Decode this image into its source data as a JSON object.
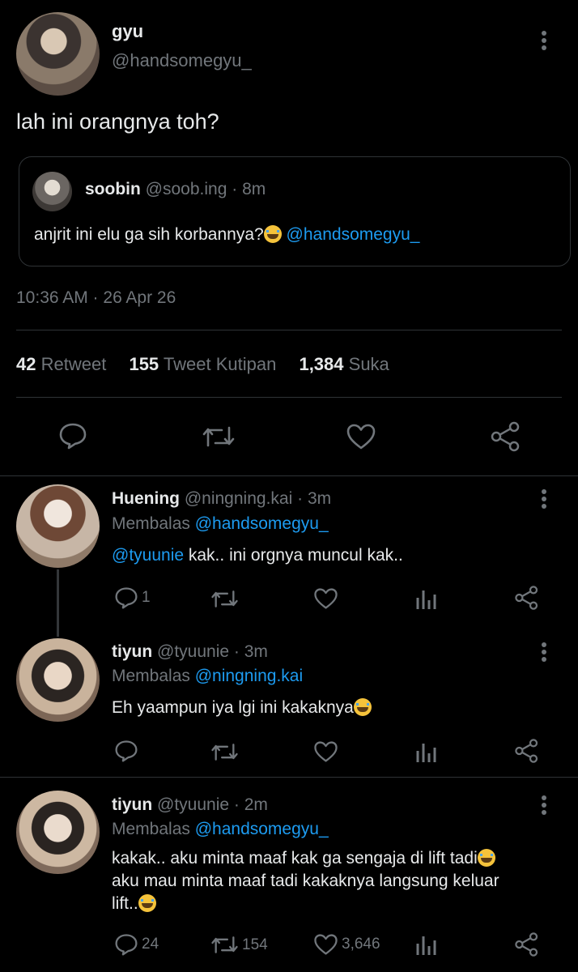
{
  "main_tweet": {
    "name": "gyu",
    "handle": "@handsomegyu_",
    "text": "lah ini orangnya toh?",
    "timestamp": "10:36 AM · 26 Apr 26",
    "quote": {
      "name": "soobin",
      "handle": "@soob.ing",
      "sep": "·",
      "time": "8m",
      "text": "anjrit ini elu ga sih korbannya?",
      "mention": "@handsomegyu_"
    },
    "stats": {
      "retweets": "42",
      "retweets_label": "Retweet",
      "quotes": "155",
      "quotes_label": "Tweet Kutipan",
      "likes": "1,384",
      "likes_label": "Suka"
    }
  },
  "replies": [
    {
      "name": "Huening",
      "handle": "@ningning.kai",
      "sep": "·",
      "time": "3m",
      "replying_label": "Membalas",
      "replying_to": "@handsomegyu_",
      "mention": "@tyuunie",
      "text": " kak.. ini orgnya muncul kak..",
      "reply_count": "1",
      "retweet_count": "",
      "like_count": ""
    },
    {
      "name": "tiyun",
      "handle": "@tyuunie",
      "sep": "·",
      "time": "3m",
      "replying_label": "Membalas",
      "replying_to": "@ningning.kai",
      "text": "Eh yaampun iya lgi ini kakaknya",
      "reply_count": "",
      "retweet_count": "",
      "like_count": ""
    },
    {
      "name": "tiyun",
      "handle": "@tyuunie",
      "sep": "·",
      "time": "2m",
      "replying_label": "Membalas",
      "replying_to": "@handsomegyu_",
      "text_line1": "kakak.. aku minta maaf kak ga sengaja di lift tadi",
      "text_line2": "aku mau minta maaf tadi kakaknya langsung keluar",
      "text_line3": "lift..",
      "reply_count": "24",
      "retweet_count": "154",
      "like_count": "3,646"
    }
  ],
  "icons": {
    "reply": "reply-icon",
    "retweet": "retweet-icon",
    "like": "heart-icon",
    "share": "share-icon",
    "analytics": "analytics-icon",
    "more": "more-icon",
    "emoji": "crying-face-emoji"
  },
  "colors": {
    "background": "#000000",
    "text": "#e7e9ea",
    "muted": "#71767b",
    "link": "#1d9bf0",
    "divider": "#2f3336"
  }
}
